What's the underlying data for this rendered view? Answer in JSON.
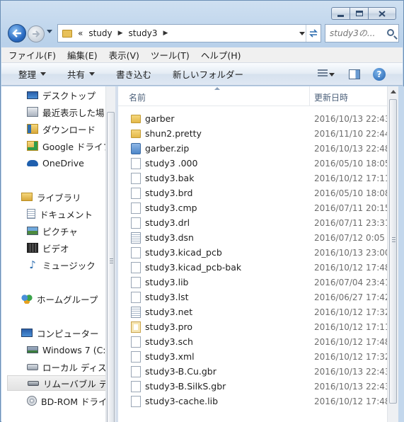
{
  "address": {
    "overflow": "«",
    "crumbs": [
      "study",
      "study3"
    ]
  },
  "search": {
    "placeholder": "study3の..."
  },
  "menubar": [
    "ファイル(F)",
    "編集(E)",
    "表示(V)",
    "ツール(T)",
    "ヘルプ(H)"
  ],
  "commands": {
    "organize": "整理",
    "share": "共有",
    "burn": "書き込む",
    "new_folder": "新しいフォルダー"
  },
  "nav": {
    "favorites": [
      {
        "label": "デスクトップ",
        "icon": "desktop-icon"
      },
      {
        "label": "最近表示した場",
        "icon": "recent-places-icon"
      },
      {
        "label": "ダウンロード",
        "icon": "downloads-icon"
      },
      {
        "label": "Google ドライブ",
        "icon": "google-drive-icon"
      },
      {
        "label": "OneDrive",
        "icon": "onedrive-icon"
      }
    ],
    "libraries": "ライブラリ",
    "library_items": [
      {
        "label": "ドキュメント",
        "icon": "documents-icon"
      },
      {
        "label": "ピクチャ",
        "icon": "pictures-icon"
      },
      {
        "label": "ビデオ",
        "icon": "videos-icon"
      },
      {
        "label": "ミュージック",
        "icon": "music-icon"
      }
    ],
    "homegroup": "ホームグループ",
    "computer": "コンピューター",
    "computer_items": [
      {
        "label": "Windows 7 (C:",
        "icon": "system-drive-icon"
      },
      {
        "label": "ローカル ディス",
        "icon": "local-disk-icon"
      },
      {
        "label": "リムーバブル デ",
        "icon": "removable-disk-icon"
      },
      {
        "label": "BD-ROM ドライ",
        "icon": "bd-rom-icon"
      }
    ]
  },
  "columns": {
    "name": "名前",
    "date": "更新日時"
  },
  "files": [
    {
      "name": "garber",
      "date": "2016/10/13 22:43",
      "type": "folder"
    },
    {
      "name": "shun2.pretty",
      "date": "2016/11/10 22:44",
      "type": "folder"
    },
    {
      "name": "garber.zip",
      "date": "2016/10/13 22:48",
      "type": "zip"
    },
    {
      "name": "study3 .000",
      "date": "2016/05/10 18:05",
      "type": "file"
    },
    {
      "name": "study3.bak",
      "date": "2016/10/12 17:11",
      "type": "file"
    },
    {
      "name": "study3.brd",
      "date": "2016/05/10 18:08",
      "type": "file"
    },
    {
      "name": "study3.cmp",
      "date": "2016/07/11 20:15",
      "type": "file"
    },
    {
      "name": "study3.drl",
      "date": "2016/07/11 23:31",
      "type": "file"
    },
    {
      "name": "study3.dsn",
      "date": "2016/07/12 0:05",
      "type": "doc"
    },
    {
      "name": "study3.kicad_pcb",
      "date": "2016/10/13 23:00",
      "type": "file"
    },
    {
      "name": "study3.kicad_pcb-bak",
      "date": "2016/10/12 17:48",
      "type": "file"
    },
    {
      "name": "study3.lib",
      "date": "2016/07/04 23:41",
      "type": "file"
    },
    {
      "name": "study3.lst",
      "date": "2016/06/27 17:42",
      "type": "file"
    },
    {
      "name": "study3.net",
      "date": "2016/10/12 17:32",
      "type": "doc"
    },
    {
      "name": "study3.pro",
      "date": "2016/10/12 17:11",
      "type": "pro"
    },
    {
      "name": "study3.sch",
      "date": "2016/10/12 17:48",
      "type": "file"
    },
    {
      "name": "study3.xml",
      "date": "2016/10/12 17:32",
      "type": "file"
    },
    {
      "name": "study3-B.Cu.gbr",
      "date": "2016/10/13 22:43",
      "type": "file"
    },
    {
      "name": "study3-B.SilkS.gbr",
      "date": "2016/10/13 22:43",
      "type": "file"
    },
    {
      "name": "study3-cache.lib",
      "date": "2016/10/12 17:48",
      "type": "file"
    }
  ]
}
